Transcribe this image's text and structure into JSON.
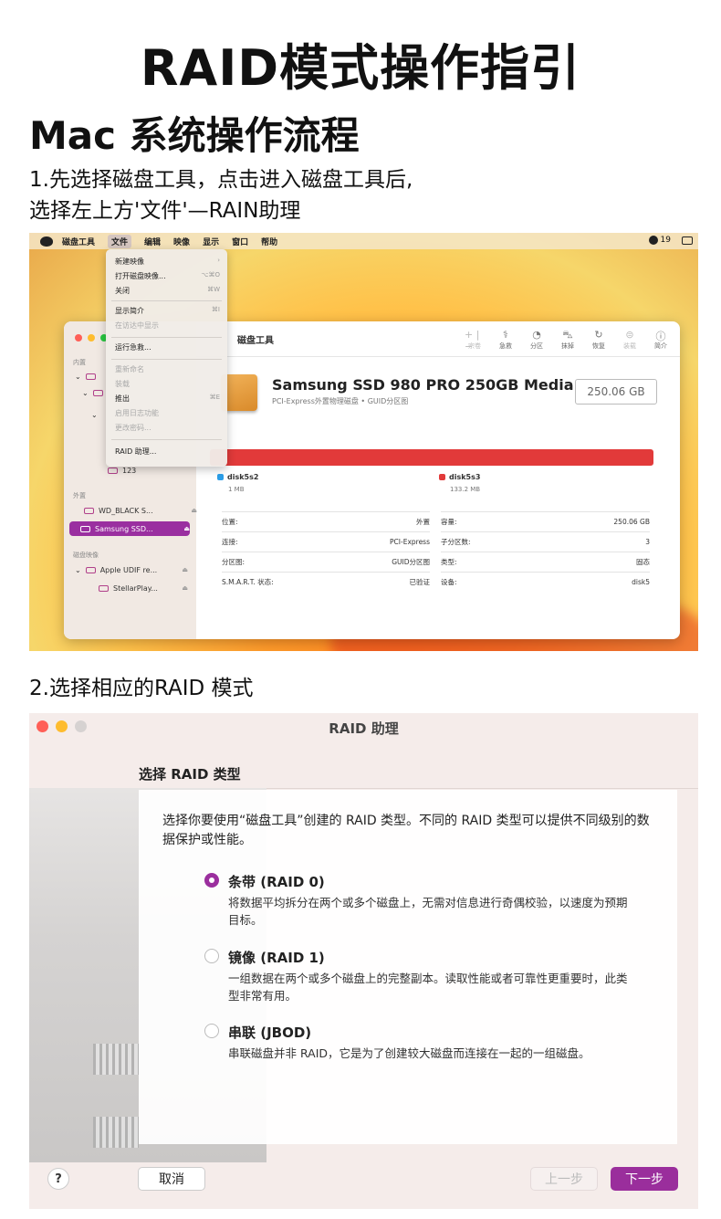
{
  "header": {
    "main_title": "RAID模式操作指引",
    "sub_title": "Mac 系统操作流程",
    "step1_line1": "1.先选择磁盘工具，点击进入磁盘工具后,",
    "step1_line2": "选择左上方'文件'—RAIN助理",
    "step2": "2.选择相应的RAID 模式"
  },
  "disk_utility": {
    "menubar": {
      "items": [
        "磁盘工具",
        "文件",
        "编辑",
        "映像",
        "显示",
        "窗口",
        "帮助"
      ],
      "status_text": "19"
    },
    "file_menu": {
      "items": [
        {
          "label": "新建映像",
          "shortcut": "›",
          "dim": false
        },
        {
          "label": "打开磁盘映像...",
          "shortcut": "⌥⌘O",
          "dim": false
        },
        {
          "label": "关闭",
          "shortcut": "⌘W",
          "dim": false
        },
        {
          "label": "显示简介",
          "shortcut": "⌘I",
          "dim": false
        },
        {
          "label": "在访达中显示",
          "shortcut": "",
          "dim": true
        },
        {
          "label": "运行急救...",
          "shortcut": "",
          "dim": false
        },
        {
          "label": "重新命名",
          "shortcut": "",
          "dim": true
        },
        {
          "label": "装载",
          "shortcut": "",
          "dim": true
        },
        {
          "label": "推出",
          "shortcut": "⌘E",
          "dim": false
        },
        {
          "label": "启用日志功能",
          "shortcut": "",
          "dim": true
        },
        {
          "label": "更改密码...",
          "shortcut": "",
          "dim": true
        },
        {
          "label": "RAID 助理...",
          "shortcut": "",
          "dim": false
        }
      ]
    },
    "toolbar_title": "磁盘工具",
    "toolbar": [
      {
        "label": "宗卷",
        "glyph": "+ | −",
        "dim": true
      },
      {
        "label": "急救",
        "glyph": "⚕",
        "dim": false
      },
      {
        "label": "分区",
        "glyph": "◔",
        "dim": false
      },
      {
        "label": "抹掉",
        "glyph": "⛍",
        "dim": false
      },
      {
        "label": "恢复",
        "glyph": "↻",
        "dim": false
      },
      {
        "label": "装载",
        "glyph": "⊜",
        "dim": true
      },
      {
        "label": "简介",
        "glyph": "ⓘ",
        "dim": false
      }
    ],
    "sidebar": {
      "internal_label": "内置",
      "volume_partial": "123",
      "external_label": "外置",
      "external_items": [
        "WD_BLACK S...",
        "Samsung SSD..."
      ],
      "images_label": "磁盘映像",
      "image_items": [
        "Apple UDIF re...",
        "StellarPlay..."
      ],
      "eject_glyph": "⏏",
      "chevron_glyph": "⌄"
    },
    "disk": {
      "name": "Samsung SSD 980 PRO 250GB Media",
      "subtitle": "PCI-Express外置物理磁盘 • GUID分区图",
      "capacity": "250.06 GB"
    },
    "partitions": [
      {
        "name": "disk5s2",
        "size": "1 MB",
        "color": "#2a9ee8"
      },
      {
        "name": "disk5s3",
        "size": "133.2 MB",
        "color": "#e23a3a"
      }
    ],
    "info_left": [
      {
        "k": "位置:",
        "v": "外置"
      },
      {
        "k": "连接:",
        "v": "PCI-Express"
      },
      {
        "k": "分区图:",
        "v": "GUID分区图"
      },
      {
        "k": "S.M.A.R.T. 状态:",
        "v": "已验证"
      }
    ],
    "info_right": [
      {
        "k": "容量:",
        "v": "250.06 GB"
      },
      {
        "k": "子分区数:",
        "v": "3"
      },
      {
        "k": "类型:",
        "v": "固态"
      },
      {
        "k": "设备:",
        "v": "disk5"
      }
    ]
  },
  "raid_assistant": {
    "title": "RAID 助理",
    "heading": "选择 RAID 类型",
    "intro": "选择你要使用“磁盘工具”创建的 RAID 类型。不同的 RAID 类型可以提供不同级别的数据保护或性能。",
    "options": [
      {
        "label": "条带 (RAID 0)",
        "desc": "将数据平均拆分在两个或多个磁盘上，无需对信息进行奇偶校验，以速度为预期目标。",
        "selected": true
      },
      {
        "label": "镜像 (RAID 1)",
        "desc": "一组数据在两个或多个磁盘上的完整副本。读取性能或者可靠性更重要时，此类型非常有用。",
        "selected": false
      },
      {
        "label": "串联 (JBOD)",
        "desc": "串联磁盘并非 RAID，它是为了创建较大磁盘而连接在一起的一组磁盘。",
        "selected": false
      }
    ],
    "help_label": "?",
    "cancel_label": "取消",
    "back_label": "上一步",
    "next_label": "下一步",
    "accent": "#9a2e9c"
  }
}
